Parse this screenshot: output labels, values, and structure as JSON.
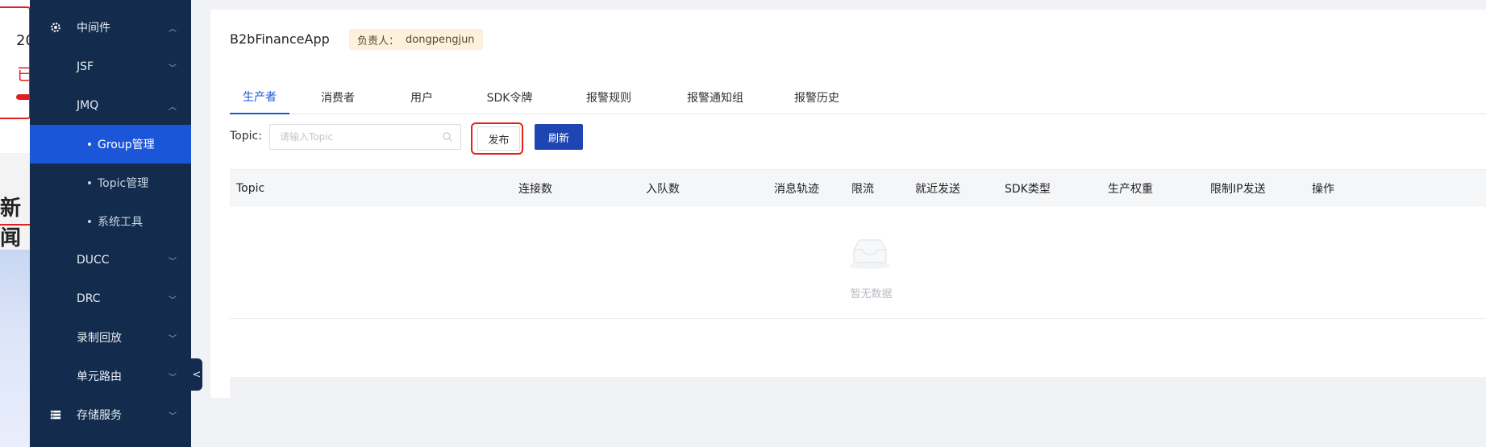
{
  "background_page": {
    "year_fragment": "20",
    "red_fragment": "已",
    "news_fragment": "新闻"
  },
  "sidebar": {
    "items": [
      {
        "label": "中间件",
        "icon": "settings-cog-icon",
        "expanded": true
      },
      {
        "label": "JSF"
      },
      {
        "label": "JMQ",
        "expanded": true
      },
      {
        "label": "Group管理",
        "active": true
      },
      {
        "label": "Topic管理"
      },
      {
        "label": "系统工具"
      },
      {
        "label": "DUCC"
      },
      {
        "label": "DRC"
      },
      {
        "label": "录制回放"
      },
      {
        "label": "单元路由"
      },
      {
        "label": "存储服务",
        "icon": "server-stack-icon"
      }
    ],
    "collapse_glyph": "<",
    "accent_color": "#1c56d8",
    "bg_color": "#132c4e"
  },
  "header": {
    "app_name": "B2bFinanceApp",
    "owner_label": "负责人：",
    "owner_value": "dongpengjun"
  },
  "tabs": [
    {
      "label": "生产者",
      "active": true
    },
    {
      "label": "消费者"
    },
    {
      "label": "用户"
    },
    {
      "label": "SDK令牌"
    },
    {
      "label": "报警规则"
    },
    {
      "label": "报警通知组"
    },
    {
      "label": "报警历史"
    }
  ],
  "filter": {
    "label": "Topic:",
    "placeholder": "请输入Topic",
    "publish_label": "发布",
    "refresh_label": "刷新"
  },
  "table": {
    "columns": [
      "Topic",
      "连接数",
      "入队数",
      "消息轨迹",
      "限流",
      "就近发送",
      "SDK类型",
      "生产权重",
      "限制IP发送",
      "操作"
    ],
    "rows": [],
    "empty_text": "暂无数据"
  }
}
